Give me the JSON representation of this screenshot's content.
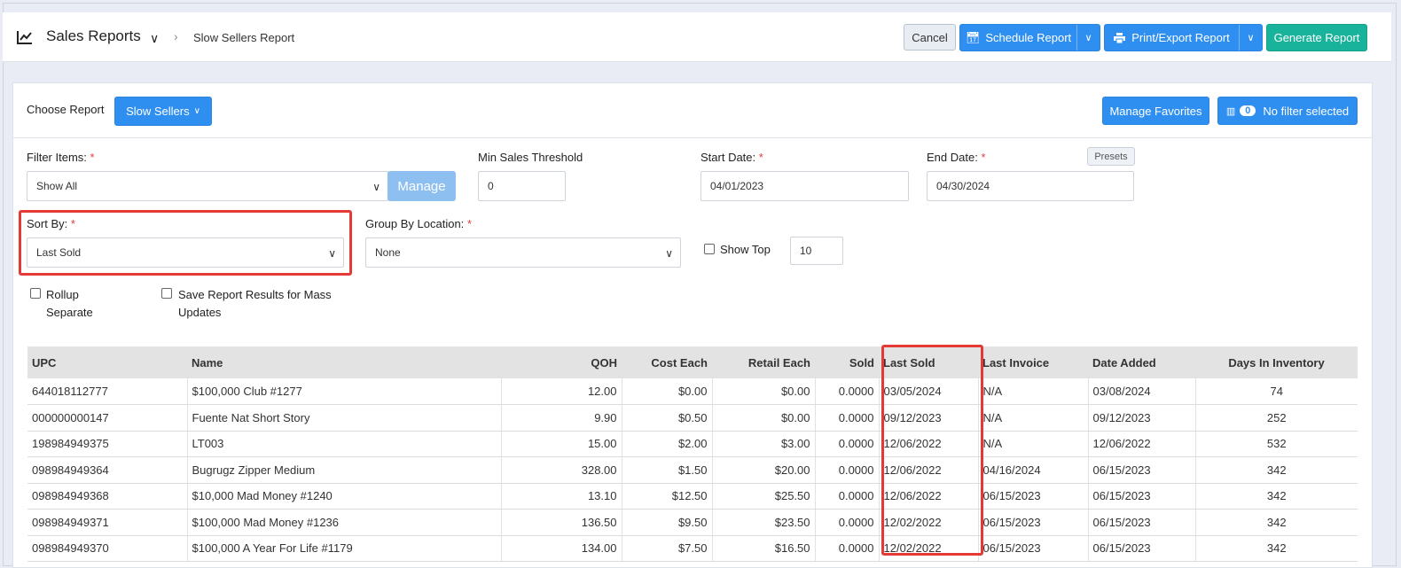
{
  "header": {
    "title": "Sales Reports",
    "breadcrumb": "Slow Sellers Report",
    "cancel_label": "Cancel",
    "schedule_label": "Schedule Report",
    "print_label": "Print/Export Report",
    "generate_label": "Generate Report"
  },
  "choose": {
    "label": "Choose Report",
    "selected": "Slow Sellers",
    "manage_favorites": "Manage Favorites",
    "filter_count": "0",
    "filter_status": "No filter selected"
  },
  "filters": {
    "filter_items_label": "Filter Items:",
    "filter_items_value": "Show All",
    "manage_label": "Manage",
    "min_sales_label": "Min Sales Threshold",
    "min_sales_value": "0",
    "start_date_label": "Start Date:",
    "start_date_value": "04/01/2023",
    "end_date_label": "End Date:",
    "end_date_value": "04/30/2024",
    "presets_label": "Presets",
    "sort_by_label": "Sort By:",
    "sort_by_value": "Last Sold",
    "group_by_label": "Group By Location:",
    "group_by_value": "None",
    "show_top_label": "Show Top",
    "show_top_value": "10",
    "rollup_label_1": "Rollup",
    "rollup_label_2": "Separate",
    "save_label_1": "Save Report Results for Mass",
    "save_label_2": "Updates",
    "required_mark": "*"
  },
  "table": {
    "columns": [
      "UPC",
      "Name",
      "QOH",
      "Cost Each",
      "Retail Each",
      "Sold",
      "Last Sold",
      "Last Invoice",
      "Date Added",
      "Days In Inventory"
    ],
    "rows": [
      [
        "644018112777",
        "$100,000 Club #1277",
        "12.00",
        "$0.00",
        "$0.00",
        "0.0000",
        "03/05/2024",
        "N/A",
        "03/08/2024",
        "74"
      ],
      [
        "000000000147",
        "Fuente Nat Short Story",
        "9.90",
        "$0.50",
        "$0.00",
        "0.0000",
        "09/12/2023",
        "N/A",
        "09/12/2023",
        "252"
      ],
      [
        "198984949375",
        "LT003",
        "15.00",
        "$2.00",
        "$3.00",
        "0.0000",
        "12/06/2022",
        "N/A",
        "12/06/2022",
        "532"
      ],
      [
        "098984949364",
        "Bugrugz Zipper Medium",
        "328.00",
        "$1.50",
        "$20.00",
        "0.0000",
        "12/06/2022",
        "04/16/2024",
        "06/15/2023",
        "342"
      ],
      [
        "098984949368",
        "$10,000 Mad Money #1240",
        "13.10",
        "$12.50",
        "$25.50",
        "0.0000",
        "12/06/2022",
        "06/15/2023",
        "06/15/2023",
        "342"
      ],
      [
        "098984949371",
        "$100,000 Mad Money #1236",
        "136.50",
        "$9.50",
        "$23.50",
        "0.0000",
        "12/02/2022",
        "06/15/2023",
        "06/15/2023",
        "342"
      ],
      [
        "098984949370",
        "$100,000 A Year For Life #1179",
        "134.00",
        "$7.50",
        "$16.50",
        "0.0000",
        "12/02/2022",
        "06/15/2023",
        "06/15/2023",
        "342"
      ]
    ]
  },
  "colors": {
    "primary": "#2f8ff0",
    "teal": "#19b39b",
    "highlight": "#e53935"
  }
}
